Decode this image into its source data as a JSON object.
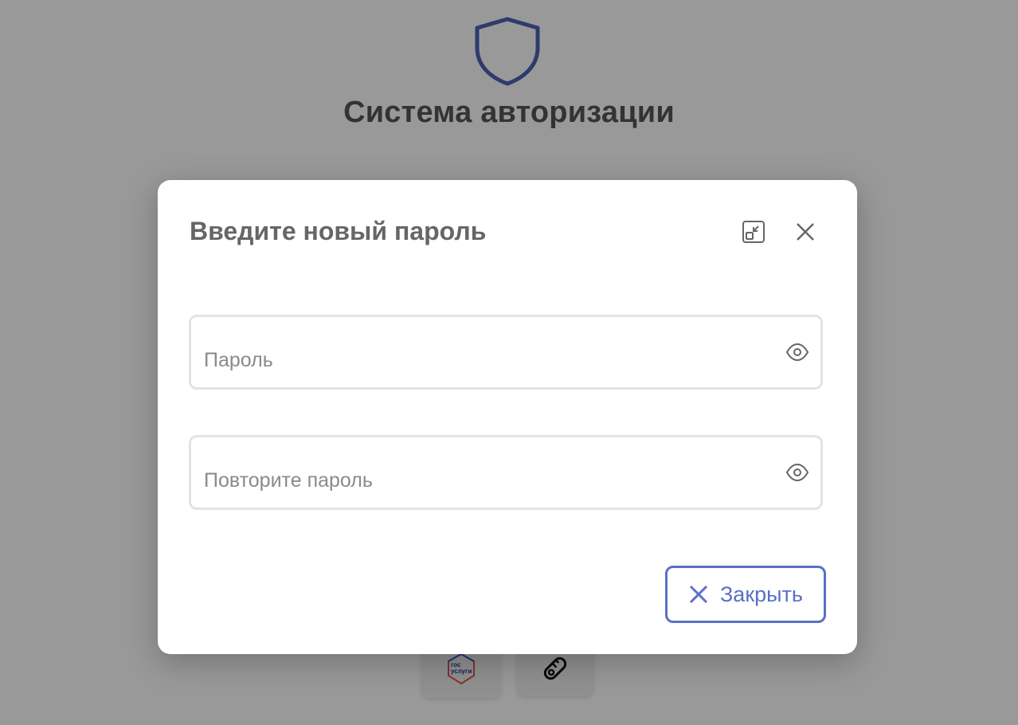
{
  "page": {
    "title": "Система авторизации",
    "gosuslugi_logo_text_top": "гос",
    "gosuslugi_logo_text_bottom": "услуги"
  },
  "modal": {
    "title": "Введите новый пароль",
    "password": {
      "value": "",
      "placeholder": "Пароль"
    },
    "password_repeat": {
      "value": "",
      "placeholder": "Повторите пароль"
    },
    "close_label": "Закрыть"
  },
  "icons": {
    "shield": "shield-icon",
    "collapse": "minimize-icon",
    "close": "close-icon",
    "eye": "eye-icon",
    "key": "key-icon"
  },
  "colors": {
    "accent": "#5a70c5",
    "title_text": "#555555",
    "modal_title": "#666666",
    "field_border": "#e3e3e3"
  }
}
